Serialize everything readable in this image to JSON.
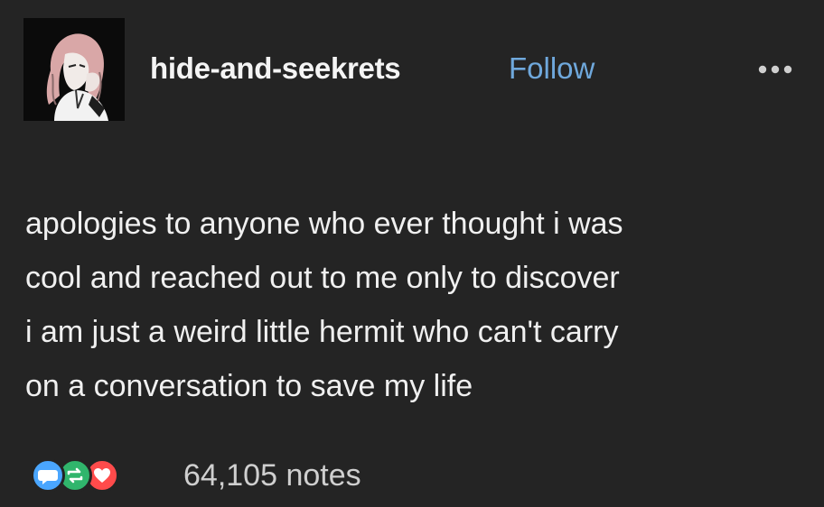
{
  "post": {
    "username": "hide-and-seekrets",
    "follow_label": "Follow",
    "more_icon": "more-horizontal-icon",
    "body_lines": [
      "apologies to anyone who ever thought i was",
      "cool and reached out to me only to discover",
      "i am just a weird little hermit who can't carry",
      "on a conversation to save my life"
    ],
    "notes": "64,105 notes",
    "note_icons": [
      "comment-icon",
      "reblog-icon",
      "heart-icon"
    ]
  },
  "colors": {
    "background": "#242424",
    "text": "#f0f0f0",
    "follow": "#6fa8dc",
    "comment": "#4aa6ff",
    "reblog": "#30b56c",
    "like": "#ff4b4b"
  }
}
